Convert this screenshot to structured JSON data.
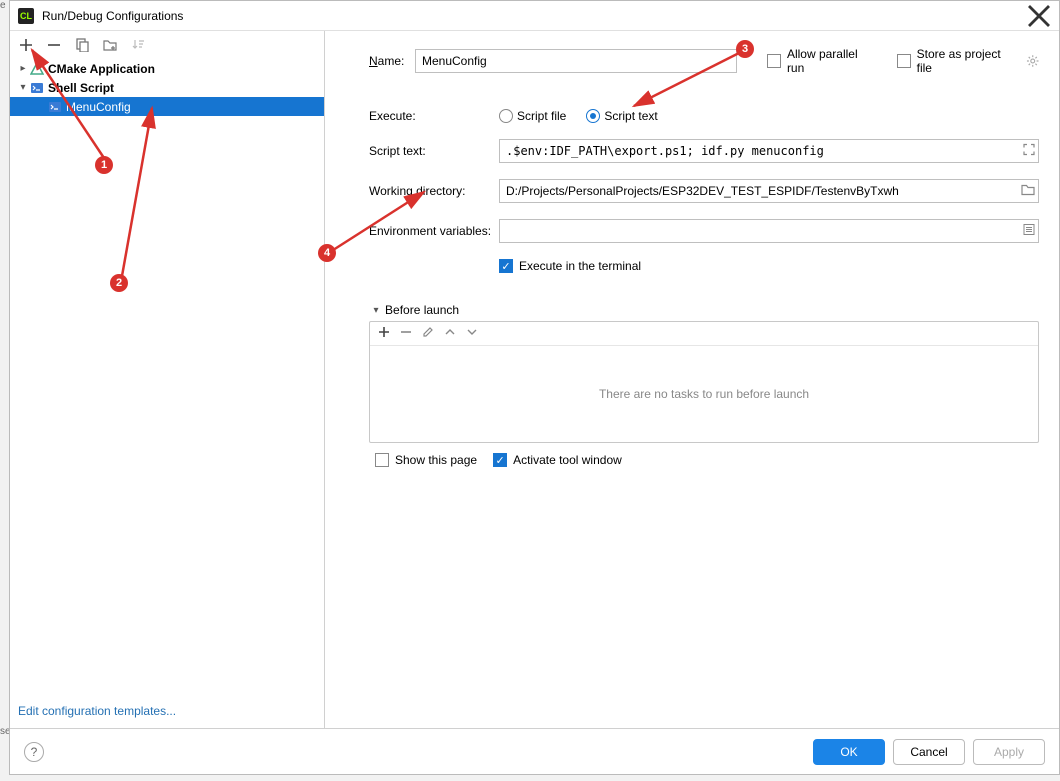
{
  "window": {
    "title": "Run/Debug Configurations"
  },
  "leftPanel": {
    "tree": [
      {
        "label": "CMake Application",
        "expanded": false,
        "depth": 0,
        "icon": "cmake",
        "bold": true
      },
      {
        "label": "Shell Script",
        "expanded": true,
        "depth": 0,
        "icon": "shell",
        "bold": true
      },
      {
        "label": "MenuConfig",
        "depth": 1,
        "icon": "shell",
        "selected": true
      }
    ],
    "editTemplatesLabel": "Edit configuration templates..."
  },
  "form": {
    "nameLabel": "Name:",
    "nameValue": "MenuConfig",
    "allowParallelLabel": "Allow parallel run",
    "allowParallelChecked": false,
    "storeProjectFileLabel": "Store as project file",
    "storeProjectFileChecked": false,
    "executeLabel": "Execute:",
    "executeOptions": {
      "scriptFile": "Script file",
      "scriptText": "Script text",
      "selected": "scriptText"
    },
    "scriptTextLabel": "Script text:",
    "scriptTextValue": ".$env:IDF_PATH\\export.ps1; idf.py menuconfig",
    "workDirLabel": "Working directory:",
    "workDirValue": "D:/Projects/PersonalProjects/ESP32DEV_TEST_ESPIDF/TestenvByTxwh",
    "envVarsLabel": "Environment variables:",
    "envVarsValue": "",
    "executeTerminalLabel": "Execute in the terminal",
    "executeTerminalChecked": true,
    "beforeLaunchLabel": "Before launch",
    "tasksEmptyText": "There are no tasks to run before launch",
    "showPageLabel": "Show this page",
    "showPageChecked": false,
    "activateToolLabel": "Activate tool window",
    "activateToolChecked": true
  },
  "buttons": {
    "ok": "OK",
    "cancel": "Cancel",
    "apply": "Apply"
  },
  "annotations": {
    "1": "1",
    "2": "2",
    "3": "3",
    "4": "4"
  }
}
